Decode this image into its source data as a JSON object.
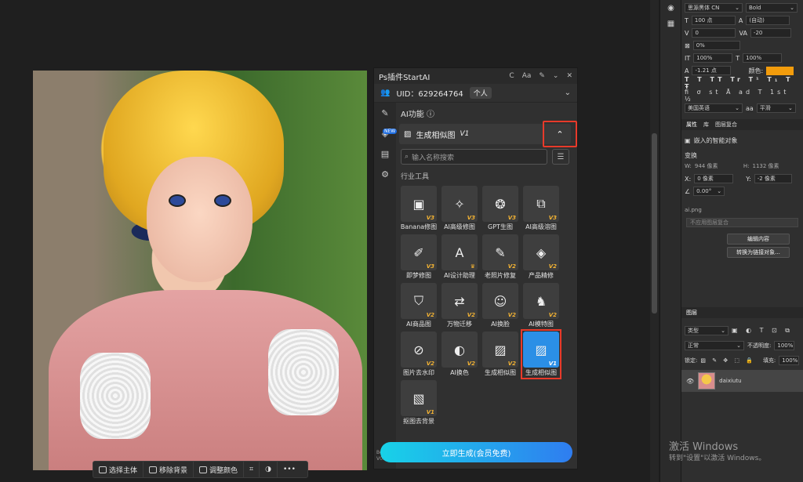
{
  "plugin": {
    "title": "Ps插件StartAI",
    "title_icons": [
      "C",
      "Aa",
      "✎",
      "⌄",
      "✕"
    ],
    "uid_label": "UID：629264764",
    "user_tag": "个人",
    "section_title": "AI功能",
    "tool_name": "生成相似图",
    "tool_version": "V1",
    "search_placeholder": "输入名称搜索",
    "category": "行业工具",
    "tiles": [
      {
        "label": "Banana修图",
        "ver": "V3",
        "icon": "▣"
      },
      {
        "label": "AI高级修图",
        "ver": "V3",
        "icon": "✧"
      },
      {
        "label": "GPT生图",
        "ver": "V3",
        "icon": "❂"
      },
      {
        "label": "AI高级溶图",
        "ver": "V3",
        "icon": "⧉"
      },
      {
        "label": "即梦修图",
        "ver": "V3",
        "icon": "✐"
      },
      {
        "label": "AI设计助理",
        "ver": "♛",
        "icon": "A"
      },
      {
        "label": "老照片修复",
        "ver": "V2",
        "icon": "✎"
      },
      {
        "label": "产品精修",
        "ver": "V2",
        "icon": "◈"
      },
      {
        "label": "AI商品图",
        "ver": "V2",
        "icon": "⛉"
      },
      {
        "label": "万物迁移",
        "ver": "V2",
        "icon": "⇄"
      },
      {
        "label": "AI换脸",
        "ver": "V2",
        "icon": "☺"
      },
      {
        "label": "AI模特图",
        "ver": "V2",
        "icon": "♞"
      },
      {
        "label": "图片去水印",
        "ver": "V2",
        "icon": "⊘"
      },
      {
        "label": "AI换色",
        "ver": "V2",
        "icon": "◐"
      },
      {
        "label": "生成相似图",
        "ver": "V2",
        "icon": "▨"
      },
      {
        "label": "生成相似图",
        "ver": "V1",
        "icon": "▨"
      },
      {
        "label": "抠图去背景",
        "ver": "V1",
        "icon": "▧"
      }
    ],
    "generate_button": "立即生成(会员免费)",
    "version_label": "Beta",
    "version_number": "V0.24.2"
  },
  "bottom_bar": {
    "buttons": [
      "选择主体",
      "移除背景",
      "调整颜色"
    ]
  },
  "right_panel": {
    "font_family": "思源黑体 CN",
    "font_style": "Bold",
    "font_size": "100 点",
    "leading": "(自动)",
    "kerning": "0",
    "tracking": "-20",
    "tsume": "0%",
    "vert_scale": "100%",
    "horiz_scale": "100%",
    "baseline": "-1.21 点",
    "color_label": "颜色:",
    "color": "#f29c0c",
    "language": "美国英语",
    "antialias": "平滑",
    "tabs": [
      "属性",
      "库",
      "图层复合"
    ],
    "smart_object": "嵌入的智能对象",
    "transform_label": "变换",
    "w_label": "W:",
    "w_value": "944 像素",
    "h_label": "H:",
    "h_value": "1132 像素",
    "x_label": "X:",
    "x_value": "0 像素",
    "y_label": "Y:",
    "y_value": "-2 像素",
    "angle": "0.00°",
    "filename": "ai.png",
    "comp_placeholder": "不应用图层复合",
    "edit_contents": "编辑内容",
    "convert_linked": "转换为链接对象...",
    "layers_title": "图层",
    "layer_kind": "类型",
    "blend_mode": "正常",
    "opacity_label": "不透明度:",
    "opacity": "100%",
    "lock_label": "锁定:",
    "fill_label": "填充:",
    "fill": "100%",
    "layer_name": "daixiutu"
  },
  "watermark": {
    "line1": "激活 Windows",
    "line2": "转到\"设置\"以激活 Windows。"
  }
}
